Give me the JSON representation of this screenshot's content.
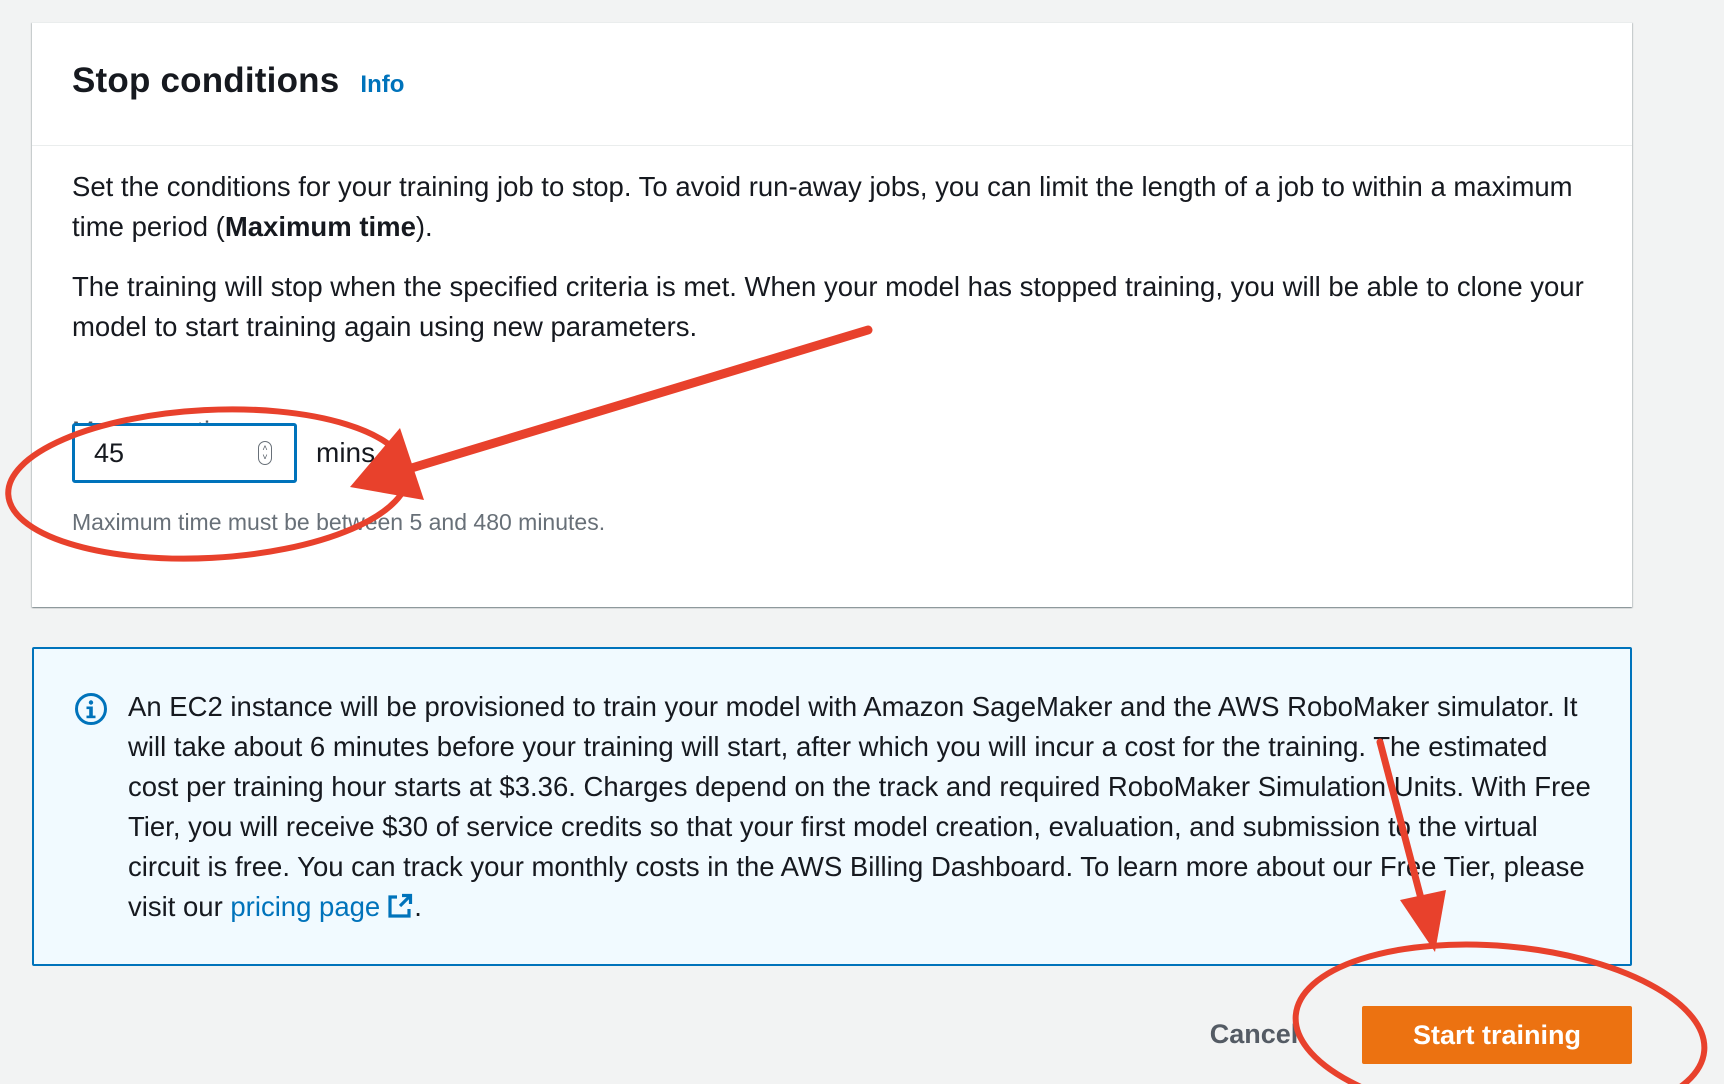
{
  "stop_conditions": {
    "title": "Stop conditions",
    "info_link": "Info",
    "para1_part1": "Set the conditions for your training job to stop. To avoid run-away jobs, you can limit the length of a job to within a maximum time period (",
    "para1_bold": "Maximum time",
    "para1_part2": ").",
    "para2": "The training will stop when the specified criteria is met. When your model has stopped training, you will be able to clone your model to start training again using new parameters.",
    "max_time_label": "Maximum time",
    "max_time_value": "45",
    "max_time_unit": "mins",
    "constraint_text": "Maximum time must be between 5 and 480 minutes."
  },
  "alert": {
    "icon": "info-circle-icon",
    "text": "An EC2 instance will be provisioned to train your model with Amazon SageMaker and the AWS RoboMaker simulator. It will take about 6 minutes before your training will start, after which you will incur a cost for the training. The estimated cost per training hour starts at $3.36. Charges depend on the track and required RoboMaker Simulation Units. With Free Tier, you will receive $30 of service credits so that your first model creation, evaluation, and submission to the virtual circuit is free. You can track your monthly costs in the AWS Billing Dashboard. To learn more about our Free Tier, please visit our ",
    "link_text": "pricing page",
    "link_icon": "external-link-icon",
    "text_end": "."
  },
  "footer": {
    "cancel_label": "Cancel",
    "start_label": "Start training"
  },
  "colors": {
    "accent": "#0073bb",
    "primary_button": "#ec7211",
    "annotation": "#e8412c"
  }
}
